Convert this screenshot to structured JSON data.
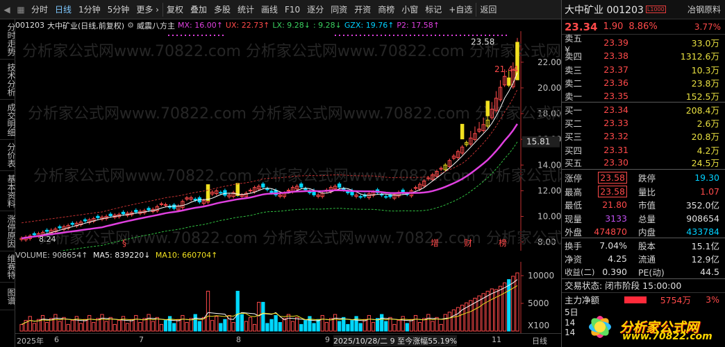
{
  "toolbar": {
    "items": [
      "分时",
      "日线",
      "1分钟",
      "5分钟",
      "更多 ›",
      "复权",
      "叠加",
      "多股",
      "统计",
      "画线",
      "F10",
      "逐分",
      "同资",
      "开资",
      "商榜",
      "小窗",
      "标记",
      "+自选",
      "返回"
    ]
  },
  "left_tabs": [
    "分时走势",
    "技术分析",
    "成交明细",
    "分价表",
    "基本资料",
    "涨停原因",
    "维赛特",
    "图谱"
  ],
  "chart_header": {
    "code": "001203",
    "name_mode": "大中矿业(日线,前复权)",
    "indicator": "威震八方主",
    "mx": "MX: 16.00↑",
    "ux": "UX: 22.73↑",
    "lx": "LX: 9.28↓",
    "lx2": ": 9.28↓",
    "gzx": "GZX: 19.76↑",
    "p2": "P2: 17.58↑"
  },
  "chart_data": {
    "type": "candlestick",
    "y_ticks": [
      "22.00",
      "20.00",
      "18.00",
      "16.00",
      "14.00",
      "12.00",
      "10.00",
      "8.00"
    ],
    "ylim": [
      7.6,
      24.2
    ],
    "current_price_label": "15.81",
    "annotations": {
      "high": "23.58",
      "high2": "21.44",
      "low": "8.24",
      "s_marker": "§",
      "marker_zeng": "增",
      "marker_cai": "财",
      "marker_bang": "榜"
    },
    "volume_ticks": [
      "10000",
      "5000",
      "X100"
    ],
    "x_labels": [
      "2025年",
      "6",
      "7",
      "8",
      "9",
      "2025/10/28/二 9 至今涨幅55.19%",
      "11",
      "日线"
    ]
  },
  "volume_header": {
    "vol": "VOLUME: 908654↑",
    "ma5": "MA5: 839220↓",
    "ma10": "MA10: 660704↑"
  },
  "right": {
    "title": "大中矿业 001203",
    "tag": "L1000",
    "extra_btn": "冶钢原料",
    "price": "23.34",
    "change": "1.90",
    "pct": "8.86%",
    "ratio": "3.77%",
    "asks": [
      {
        "l": "卖五 ¥",
        "p": "23.39",
        "v": "33.0万"
      },
      {
        "l": "卖四",
        "p": "23.38",
        "v": "1312.6万"
      },
      {
        "l": "卖三",
        "p": "23.37",
        "v": "10.3万"
      },
      {
        "l": "卖二",
        "p": "23.36",
        "v": "23.8万"
      },
      {
        "l": "卖一",
        "p": "23.35",
        "v": "152.5万"
      }
    ],
    "bids": [
      {
        "l": "买一",
        "p": "23.34",
        "v": "208.4万"
      },
      {
        "l": "买二",
        "p": "23.33",
        "v": "2.6万"
      },
      {
        "l": "买三",
        "p": "23.32",
        "v": "20.8万"
      },
      {
        "l": "买四",
        "p": "23.31",
        "v": "4.2万"
      },
      {
        "l": "买五",
        "p": "23.30",
        "v": "24.5万"
      }
    ],
    "stats": [
      {
        "k": "涨停",
        "v": "23.58",
        "k2": "跌停",
        "v2": "19.30"
      },
      {
        "k": "最高",
        "v": "23.58",
        "k2": "量比",
        "v2": "1.07"
      },
      {
        "k": "最低",
        "v": "21.80",
        "k2": "市值",
        "v2": "352.0亿"
      },
      {
        "k": "现量",
        "v": "3133",
        "k2": "总量",
        "v2": "908654"
      },
      {
        "k": "外盘",
        "v": "474870",
        "k2": "内盘",
        "v2": "433784"
      },
      {
        "k": "换手",
        "v": "7.04%",
        "k2": "股本",
        "v2": "15.1亿"
      },
      {
        "k": "净资",
        "v": "4.25",
        "k2": "流通",
        "v2": "12.9亿"
      },
      {
        "k": "收益(二)",
        "v": "0.390",
        "k2": "PE(动)",
        "v2": "44.5"
      }
    ],
    "trade_status": "交易状态: 闭市阶段 15:00:00",
    "main_flow_label": "主力净额",
    "main_flow_value": "5754万",
    "main_flow_pct": "3%",
    "row_5": "5日",
    "row_14a": "14",
    "row_14b": "14"
  },
  "brand": {
    "text": "分析家公式网",
    "url": "www.70822.com"
  },
  "colors": {
    "up": "#ff4a4a",
    "down": "#00e0ff",
    "ma_white": "#ffffff",
    "ma_magenta": "#e040e0",
    "ma_yellow": "#f0e020"
  }
}
